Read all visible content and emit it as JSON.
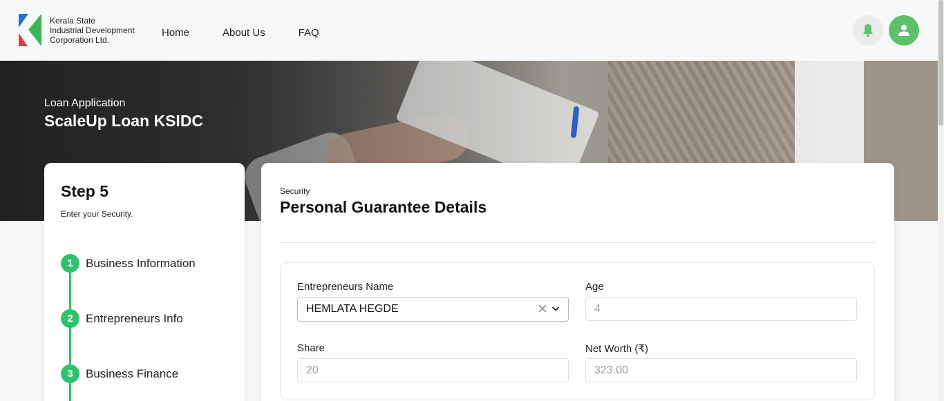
{
  "header": {
    "logo_text": [
      "Kerala State",
      "Industrial Development",
      "Corporation Ltd."
    ],
    "nav": [
      {
        "label": "Home"
      },
      {
        "label": "About Us"
      },
      {
        "label": "FAQ"
      }
    ],
    "icons": {
      "notification": "bell-icon",
      "profile": "user-icon"
    },
    "colors": {
      "accent_green": "#5fc06a",
      "logo_blue": "#1e74c9",
      "logo_red": "#e03a3a",
      "logo_green": "#3fb25a"
    }
  },
  "hero": {
    "subtitle": "Loan Application",
    "title": "ScaleUp Loan KSIDC"
  },
  "steps": {
    "title": "Step 5",
    "description": "Enter your Security.",
    "items": [
      {
        "number": "1",
        "label": "Business Information"
      },
      {
        "number": "2",
        "label": "Entrepreneurs Info"
      },
      {
        "number": "3",
        "label": "Business Finance"
      }
    ],
    "color": "#2fc26e"
  },
  "form": {
    "section_label": "Security",
    "section_title": "Personal Guarantee Details",
    "fields": {
      "entrepreneur_name": {
        "label": "Entrepreneurs Name",
        "value": "HEMLATA HEGDE"
      },
      "age": {
        "label": "Age",
        "value": "4"
      },
      "share": {
        "label": "Share",
        "value": "20"
      },
      "net_worth": {
        "label": "Net Worth (₹)",
        "value": "323.00"
      }
    }
  }
}
